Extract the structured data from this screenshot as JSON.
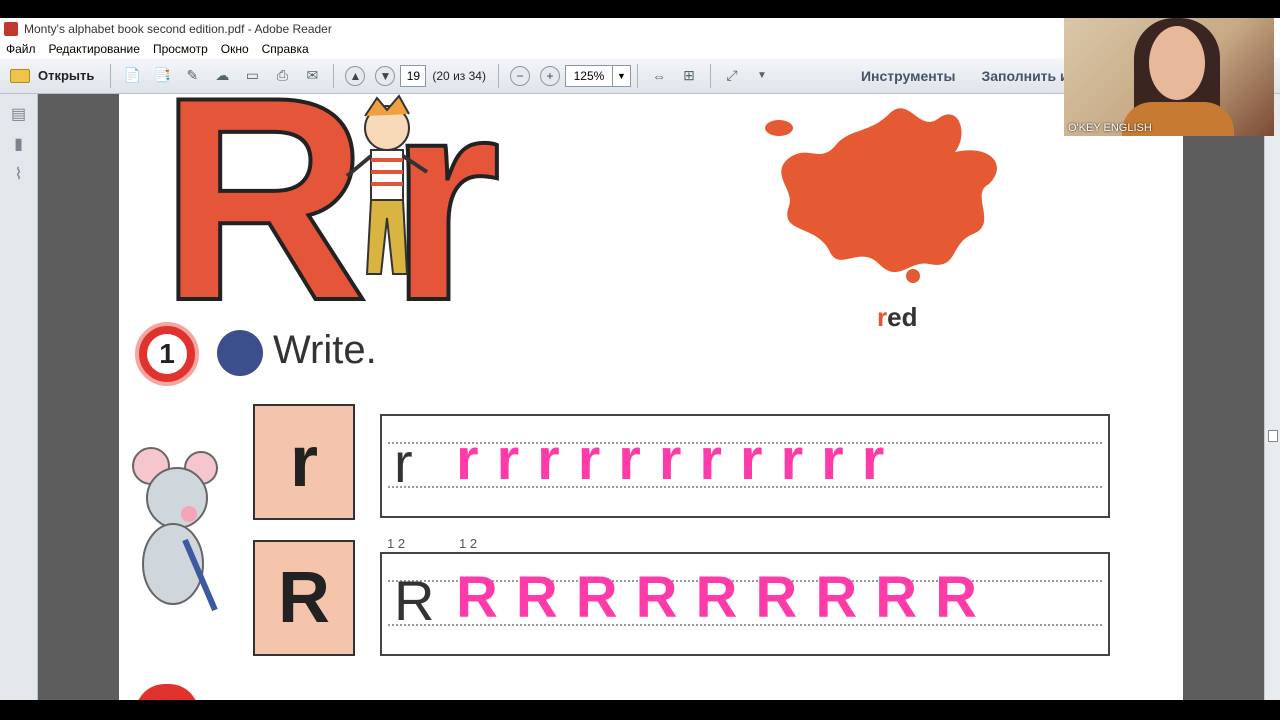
{
  "window": {
    "title": "Monty's alphabet book second edition.pdf - Adobe Reader"
  },
  "menu": [
    "Файл",
    "Редактирование",
    "Просмотр",
    "Окно",
    "Справка"
  ],
  "toolbar": {
    "open_label": "Открыть",
    "page_number": "19",
    "page_count": "(20 из 34)",
    "zoom": "125%",
    "tools_label": "Инструменты",
    "fill_label": "Заполнить и"
  },
  "webcam": {
    "label": "O'KEY ENGLISH"
  },
  "page": {
    "big_letters": "Rr",
    "word": "red",
    "word_first": "r",
    "word_rest": "ed",
    "exercise_number": "1",
    "exercise_title": "Write.",
    "row1": {
      "letter": "r",
      "trace": "r",
      "handwriting": "rrrrrrrrrrr"
    },
    "row2": {
      "letter": "R",
      "trace": "R",
      "stroke_order": "1 2",
      "handwriting": "RRRRRRRRR"
    }
  },
  "icons": [
    "pdf-icon",
    "folder-icon",
    "arrow-up-icon",
    "arrow-down-icon",
    "zoom-out-icon",
    "zoom-in-icon",
    "pages-icon",
    "bookmark-icon",
    "paperclip-icon"
  ]
}
